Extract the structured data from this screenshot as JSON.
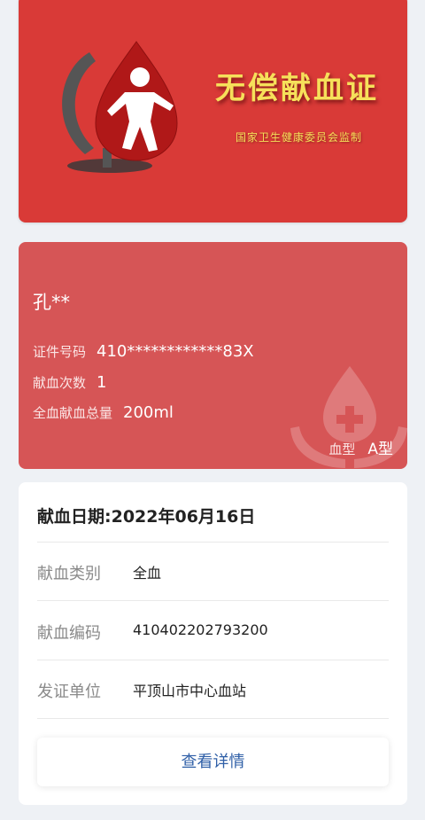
{
  "certificate": {
    "title": "无偿献血证",
    "subtitle": "国家卫生健康委员会监制"
  },
  "donor": {
    "name": "孔**",
    "id_label": "证件号码",
    "id_value": "410************83X",
    "count_label": "献血次数",
    "count_value": "1",
    "total_label": "全血献血总量",
    "total_value": "200ml",
    "blood_type_label": "血型",
    "blood_type_value": "A型"
  },
  "donation": {
    "date_title": "献血日期:2022年06月16日",
    "type_label": "献血类别",
    "type_value": "全血",
    "code_label": "献血编码",
    "code_value": "410402202793200",
    "issuer_label": "发证单位",
    "issuer_value": "平顶山市中心血站",
    "details_button": "查看详情"
  },
  "colors": {
    "certificate_red": "#d93a37",
    "info_card_red": "#d65556",
    "title_gold": "#f6e05a",
    "button_blue": "#2f5fa7"
  },
  "icons": {
    "logo": "blood-donation-logo-icon",
    "watermark": "blood-drop-hands-icon"
  }
}
